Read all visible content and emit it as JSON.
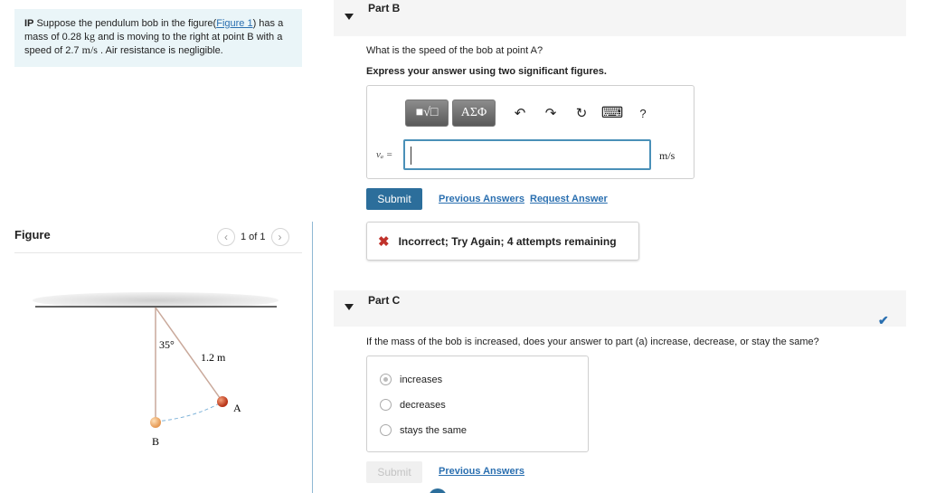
{
  "problem": {
    "prefix": "IP",
    "text_1": " Suppose the pendulum bob in the figure(",
    "figure_link": "Figure 1",
    "text_2": ") has a mass of 0.28 ",
    "mass_unit": "kg",
    "text_3": " and is moving to the right at point B with a speed of 2.7 ",
    "speed_unit": "m/s",
    "text_4": " . Air resistance is negligible."
  },
  "figure": {
    "label": "Figure",
    "pager": "1 of 1",
    "prev_icon": "chevron-left-icon",
    "next_icon": "chevron-right-icon",
    "angle_label": "35°",
    "length_label": "1.2 m",
    "point_a": "A",
    "point_b": "B"
  },
  "part_b": {
    "title": "Part B",
    "question": "What is the speed of the bob at point A?",
    "instruction": "Express your answer using two significant figures.",
    "toolbar": {
      "sqrt_label": "■√□",
      "greek_label": "ΑΣΦ",
      "undo": "↶",
      "redo": "↷",
      "reset": "↻",
      "keyboard": "⌨",
      "help": "?"
    },
    "var_label": "vₐ =",
    "input_value": "",
    "unit": "m/s",
    "submit": "Submit",
    "previous_answers": "Previous Answers",
    "request_answer": "Request Answer",
    "feedback": "Incorrect; Try Again; 4 attempts remaining"
  },
  "part_c": {
    "title": "Part C",
    "question": "If the mass of the bob is increased, does your answer to part (a) increase, decrease, or stay the same?",
    "options": [
      "increases",
      "decreases",
      "stays the same"
    ],
    "selected_index": 0,
    "submit": "Submit",
    "previous_answers": "Previous Answers"
  },
  "colors": {
    "accent": "#2c6e9b",
    "link": "#2a6fb0",
    "error": "#c0322b",
    "problem_bg": "#eaf5f8"
  }
}
